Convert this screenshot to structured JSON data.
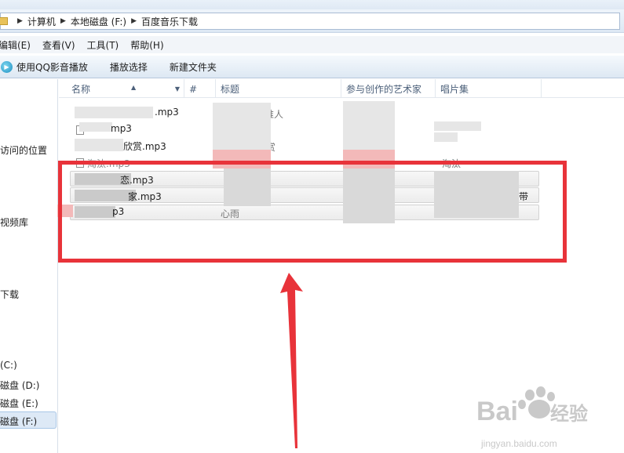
{
  "address": {
    "crumbs": [
      "计算机",
      "本地磁盘 (F:)",
      "百度音乐下载"
    ]
  },
  "menu": {
    "items": [
      "编辑(E)",
      "查看(V)",
      "工具(T)",
      "帮助(H)"
    ]
  },
  "toolbar": {
    "play_qq": "使用QQ影音播放",
    "play_selected": "播放选择",
    "new_folder": "新建文件夹"
  },
  "nav": {
    "recent": "访问的位置",
    "videos": "视频库",
    "downloads": "下载",
    "drive_c": "(C:)",
    "drive_d": "磁盘 (D:)",
    "drive_e": "磁盘 (E:)",
    "drive_f": "磁盘 (F:)"
  },
  "columns": {
    "name": "名称",
    "number": "#",
    "title": "标题",
    "artist": "参与创作的艺术家",
    "album": "唱片集"
  },
  "files": [
    {
      "name": ".mp3",
      "artist_fragment": "唯人"
    },
    {
      "name": "mp3"
    },
    {
      "name": "欣赏.mp3",
      "artist_fragment": "赏"
    },
    {
      "name": "淘汰.mp3",
      "album": "淘汰"
    },
    {
      "name": "恋.mp3"
    },
    {
      "name": "家.mp3",
      "album_fragment": "带"
    },
    {
      "name": "p3",
      "title": "心雨"
    }
  ],
  "watermark": {
    "brand": "Bai",
    "brand_cn": "经验",
    "url": "jingyan.baidu.com"
  },
  "colors": {
    "highlight_red": "#e8333a",
    "selection_bg": "#dde9f6"
  }
}
